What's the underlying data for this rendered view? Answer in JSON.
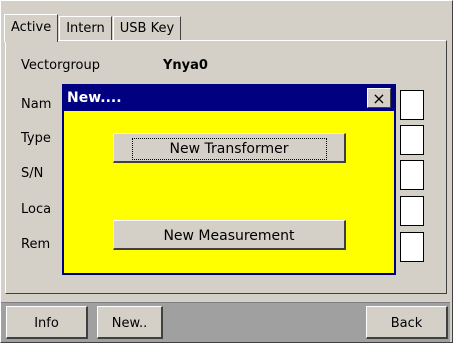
{
  "tabs": [
    {
      "label": "Active"
    },
    {
      "label": "Intern"
    },
    {
      "label": "USB Key"
    }
  ],
  "fields": {
    "vectorgroup_label": "Vectorgroup",
    "vectorgroup_value": "Ynya0",
    "name_label": "Nam",
    "type_label": "Type",
    "sn_label": "S/N",
    "location_label": "Loca",
    "remark_label": "Rem"
  },
  "dialog": {
    "title": "New....",
    "close_label": "×",
    "new_transformer_label": "New Transformer",
    "new_measurement_label": "New Measurement"
  },
  "bottom": {
    "info_label": "Info",
    "new_label": "New..",
    "back_label": "Back"
  },
  "colors": {
    "dialog_background": "#ffff00",
    "title_bar": "#000080",
    "window_face": "#d4d0c8"
  }
}
